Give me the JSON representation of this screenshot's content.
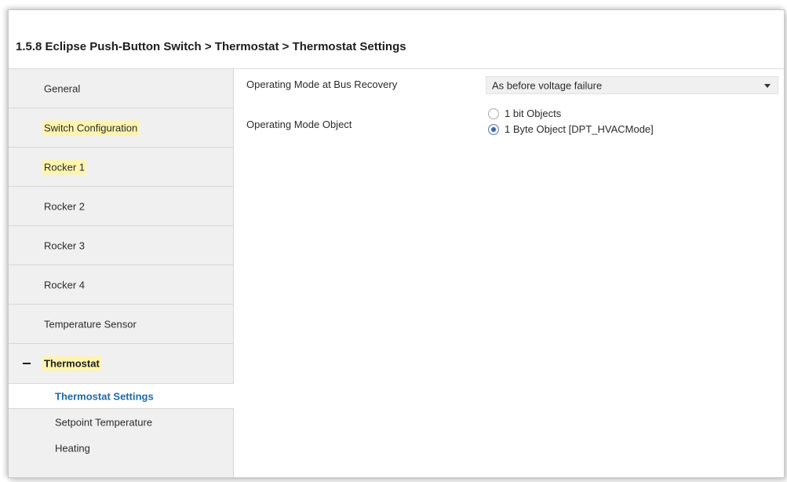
{
  "window": {
    "title": "1.5.8 Eclipse Push-Button Switch > Thermostat > Thermostat Settings"
  },
  "sidebar": {
    "items": [
      {
        "label": "General"
      },
      {
        "label": "Switch Configuration"
      },
      {
        "label": "Rocker 1"
      },
      {
        "label": "Rocker 2"
      },
      {
        "label": "Rocker 3"
      },
      {
        "label": "Rocker 4"
      },
      {
        "label": "Temperature Sensor"
      },
      {
        "label": "Thermostat"
      }
    ],
    "subitems": [
      {
        "label": "Thermostat Settings"
      },
      {
        "label": "Setpoint Temperature"
      },
      {
        "label": "Heating"
      }
    ]
  },
  "content": {
    "bus_recovery": {
      "label": "Operating Mode at Bus Recovery",
      "value": "As before voltage failure"
    },
    "mode_object": {
      "label": "Operating Mode Object",
      "options": [
        {
          "label": "1 bit Objects"
        },
        {
          "label": "1 Byte Object [DPT_HVACMode]"
        }
      ]
    }
  },
  "colors": {
    "highlight": "#fdf4b0",
    "active_link": "#1f6aa8",
    "sidebar_bg": "#f0f0f0"
  }
}
